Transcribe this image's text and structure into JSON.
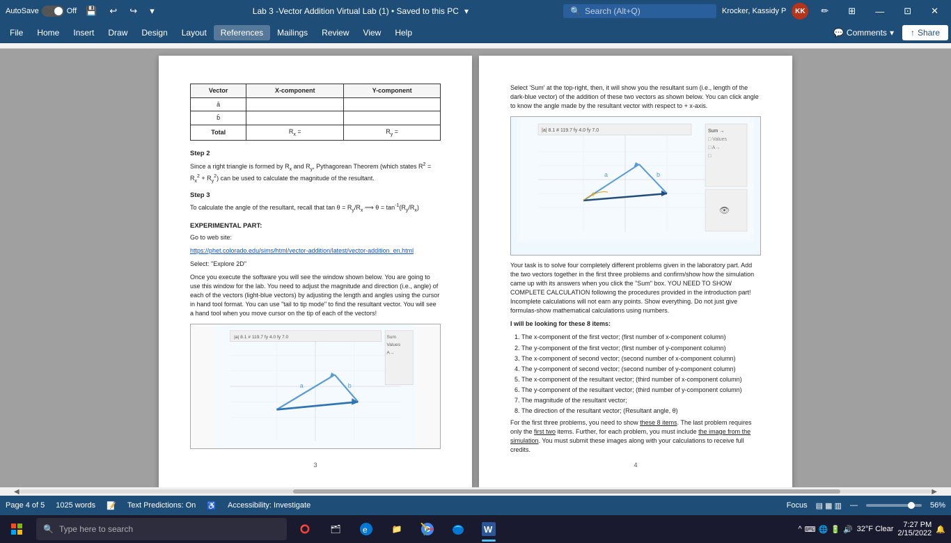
{
  "titlebar": {
    "autosave_label": "AutoSave",
    "autosave_state": "Off",
    "title": "Lab 3 -Vector Addition Virtual Lab (1) • Saved to this PC",
    "title_arrow": "▾",
    "search_placeholder": "Search (Alt+Q)",
    "user_name": "Krocker, Kassidy P",
    "user_initials": "KK"
  },
  "menubar": {
    "items": [
      "File",
      "Home",
      "Insert",
      "Draw",
      "Design",
      "Layout",
      "References",
      "Mailings",
      "Review",
      "View",
      "Help"
    ],
    "comments_label": "Comments",
    "share_label": "Share"
  },
  "doc": {
    "page3": {
      "table": {
        "headers": [
          "Vector",
          "X-component",
          "Y-component"
        ],
        "rows": [
          [
            "a̅",
            "",
            ""
          ],
          [
            "b̅",
            "",
            ""
          ],
          [
            "Total",
            "Rx =",
            "Ry ="
          ]
        ]
      },
      "step2_heading": "Step 2",
      "step2_text": "Since a right triangle is formed by Rx and Ry, Pythagorean Theorem (which states R² = Rx² + Ry²) can be used to calculate the magnitude of the resultant.",
      "step3_heading": "Step 3",
      "step3_text": "To calculate the angle of the resultant, recall that tan θ = Ry/Rx ⟹ θ = tan⁻¹(Ry/Rx)",
      "exp_heading": "EXPERIMENTAL PART:",
      "goto_label": "Go to web site:",
      "link_text": "https://phet.colorado.edu/sims/html/vector-addition/latest/vector-addition_en.html",
      "select_label": "Select: \"Explore 2D\"",
      "exp_para": "Once you execute the software you will see the window shown below. You are going to use this window for the lab. You need to adjust the magnitude and direction (i.e., angle) of each of the vectors (light-blue vectors) by adjusting the length and angles using the cursor in hand tool format. You can use \"tail to tip mode\" to find the resultant vector. You will see a hand tool when you move cursor on the tip of each of the vectors!",
      "page_num": "3"
    },
    "page4": {
      "intro_text": "Select 'Sum' at the top-right, then, it will show you the resultant sum (i.e., length of the dark-blue vector) of the addition of these two vectors as shown below. You can click angle to know the angle made by the resultant vector with respect to + x-axis.",
      "task_text": "Your task is to solve four completely different problems given in the laboratory part. Add the two vectors together in the first three problems and confirm/show how the simulation came up with its answers when you click the \"Sum\" box. YOU NEED TO SHOW COMPLETE CALCULATION following the procedures provided in the introduction part! Incomplete calculations will not earn any points. Show everything. Do not just give formulas-show mathematical calculations using numbers.",
      "looking_heading": "I will be looking for these 8 items:",
      "items": [
        "The x-component of the first vector; (first number of x-component column)",
        "The y-component of the first vector; (first number of y-component column)",
        "The x-component of second vector; (second number of x-component column)",
        "The y-component of second vector; (second number of y-component column)",
        "The x-component of the resultant vector; (third number of x-component column)",
        "The y-component of the resultant vector; (third number of y-component column)",
        "The magnitude of the resultant vector;",
        "The direction of the resultant vector; (Resultant angle, θ)"
      ],
      "final_para": "For the first three problems, you need to show these 8 items. The last problem requires only the first two items. Further, for each problem, you must include the image from the simulation. You must submit these images along with your calculations to receive full credits.",
      "page_num": "4"
    }
  },
  "statusbar": {
    "page_info": "Page 4 of 5",
    "word_count": "1025 words",
    "text_predictions": "Text Predictions: On",
    "accessibility": "Accessibility: Investigate",
    "focus_label": "Focus",
    "zoom_level": "56%"
  },
  "taskbar": {
    "search_placeholder": "Type here to search",
    "weather": "32°F  Clear",
    "time": "7:27 PM",
    "date": "2/15/2022"
  }
}
